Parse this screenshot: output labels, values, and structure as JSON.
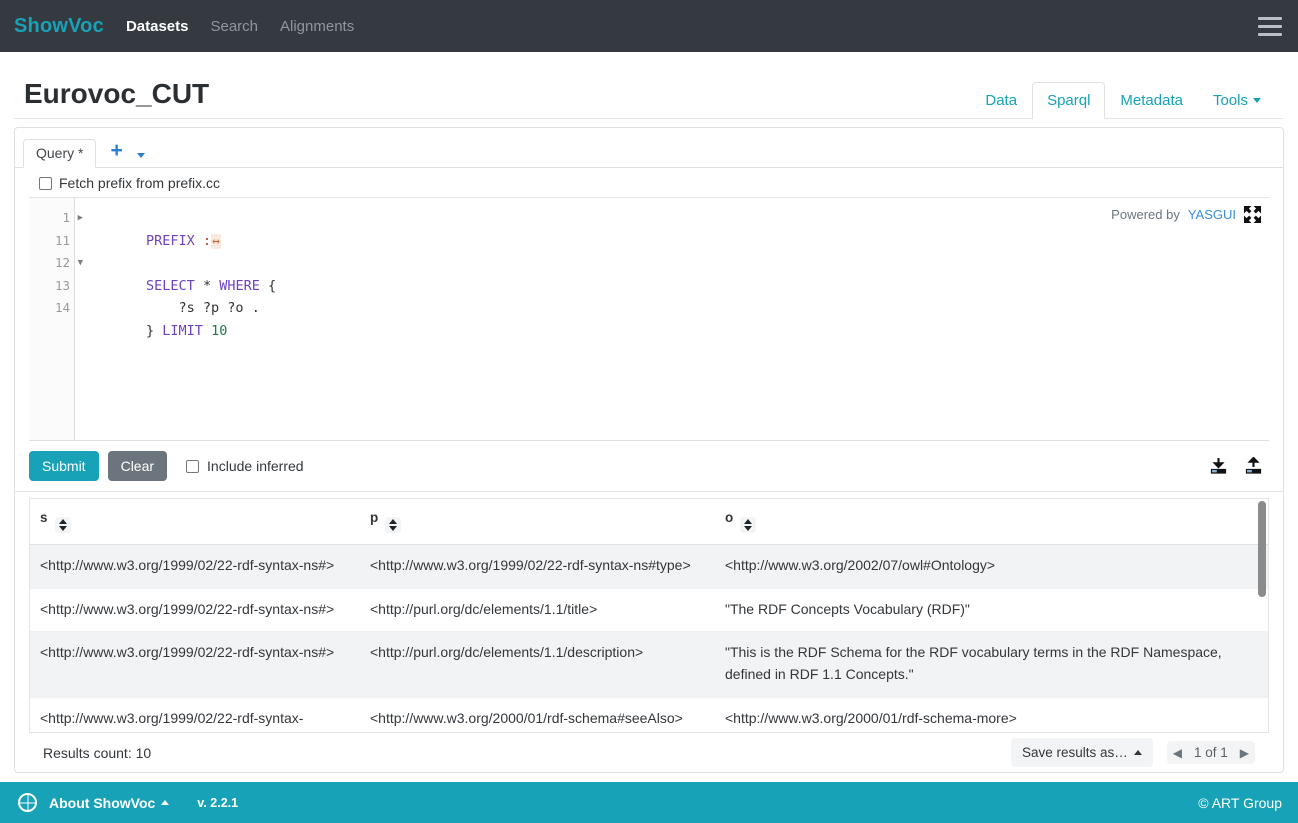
{
  "navbar": {
    "brand": "ShowVoc",
    "links": [
      {
        "label": "Datasets",
        "active": true
      },
      {
        "label": "Search",
        "active": false
      },
      {
        "label": "Alignments",
        "active": false
      }
    ],
    "menu_icon": "hamburger-icon"
  },
  "header": {
    "title": "Eurovoc_CUT",
    "tabs": [
      {
        "label": "Data",
        "active": false
      },
      {
        "label": "Sparql",
        "active": true
      },
      {
        "label": "Metadata",
        "active": false
      },
      {
        "label": "Tools",
        "active": false,
        "has_caret": true
      }
    ]
  },
  "query_panel": {
    "tab_label": "Query *",
    "add_icon": "+",
    "dropdown_icon": "chevron-down-icon",
    "prefix_checkbox_label": "Fetch prefix from prefix.cc",
    "prefix_checked": false,
    "editor": {
      "gutter": [
        "1",
        "11",
        "12",
        "13",
        "14"
      ],
      "lines": [
        {
          "number": "1",
          "fold": "open",
          "tokens": [
            {
              "t": "PREFIX",
              "c": "kw"
            },
            {
              "t": " ",
              "c": "plain"
            },
            {
              "t": ":",
              "c": "colon"
            },
            {
              "t": "↔",
              "c": "foldmark"
            }
          ]
        },
        {
          "number": "11",
          "fold": "none",
          "tokens": []
        },
        {
          "number": "12",
          "fold": "closed",
          "tokens": [
            {
              "t": "SELECT",
              "c": "kw"
            },
            {
              "t": " * ",
              "c": "punct"
            },
            {
              "t": "WHERE",
              "c": "kw"
            },
            {
              "t": " {",
              "c": "punct"
            }
          ]
        },
        {
          "number": "13",
          "fold": "none",
          "tokens": [
            {
              "t": "    ?s ?p ?o .",
              "c": "var"
            }
          ]
        },
        {
          "number": "14",
          "fold": "none",
          "tokens": [
            {
              "t": "} ",
              "c": "punct"
            },
            {
              "t": "LIMIT",
              "c": "kw"
            },
            {
              "t": " ",
              "c": "plain"
            },
            {
              "t": "10",
              "c": "num"
            }
          ]
        }
      ],
      "powered_by_prefix": "Powered by",
      "powered_by_link": "YASGUI",
      "fullscreen_icon": "fullscreen-icon"
    },
    "submit_label": "Submit",
    "clear_label": "Clear",
    "include_inferred_label": "Include inferred",
    "include_inferred_checked": false,
    "download_icon": "download-icon",
    "upload_icon": "upload-icon"
  },
  "results": {
    "columns": [
      "s",
      "p",
      "o"
    ],
    "rows": [
      {
        "s": "<http://www.w3.org/1999/02/22-rdf-syntax-ns#>",
        "p": "<http://www.w3.org/1999/02/22-rdf-syntax-ns#type>",
        "o": "<http://www.w3.org/2002/07/owl#Ontology>"
      },
      {
        "s": "<http://www.w3.org/1999/02/22-rdf-syntax-ns#>",
        "p": "<http://purl.org/dc/elements/1.1/title>",
        "o": "\"The RDF Concepts Vocabulary (RDF)\""
      },
      {
        "s": "<http://www.w3.org/1999/02/22-rdf-syntax-ns#>",
        "p": "<http://purl.org/dc/elements/1.1/description>",
        "o": "\"This is the RDF Schema for the RDF vocabulary terms in the RDF Namespace, defined in RDF 1.1 Concepts.\""
      },
      {
        "s": "<http://www.w3.org/1999/02/22-rdf-syntax-",
        "p": "<http://www.w3.org/2000/01/rdf-schema#seeAlso>",
        "o": "<http://www.w3.org/2000/01/rdf-schema-more>"
      }
    ],
    "count_label": "Results count: 10",
    "save_label": "Save results as…",
    "page_label": "1 of 1"
  },
  "footer": {
    "about_label": "About ShowVoc",
    "version": "v. 2.2.1",
    "copyright": "© ART Group",
    "globe_icon": "globe-icon"
  },
  "colors": {
    "navbar_bg": "#343a40",
    "brand": "#17a2b8",
    "accent": "#17a2b8",
    "link": "#3c8dde",
    "tab_active_text": "#17a2b8"
  }
}
